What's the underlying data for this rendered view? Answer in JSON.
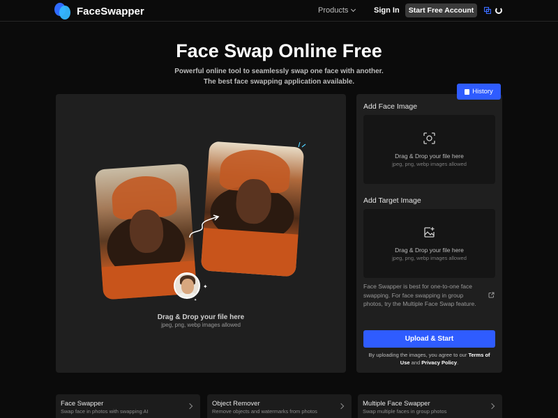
{
  "header": {
    "logo_text": "FaceSwapper",
    "products_label": "Products",
    "sign_in_label": "Sign In",
    "start_label": "Start Free Account"
  },
  "hero": {
    "title": "Face Swap Online Free",
    "subtitle": "Powerful online tool to seamlessly swap one face with another. The best face swapping application available."
  },
  "drop_panel": {
    "title": "Drag & Drop your file here",
    "subtitle": "jpeg, png, webp images allowed"
  },
  "right_panel": {
    "history_label": "History",
    "face_section_label": "Add Face Image",
    "face_upload_title": "Drag & Drop your file here",
    "face_upload_sub": "jpeg, png, webp images allowed",
    "target_section_label": "Add Target Image",
    "target_upload_title": "Drag & Drop your file here",
    "target_upload_sub": "jpeg, png, webp images allowed",
    "note": "Face Swapper is best for one-to-one face swapping. For face swapping in group photos, try the Multiple Face Swap feature.",
    "upload_button": "Upload & Start",
    "terms_prefix": "By uploading the images, you agree to our ",
    "terms_link": "Terms of Use",
    "terms_and": " and ",
    "privacy_link": "Privacy Policy",
    "terms_suffix": "."
  },
  "tools": [
    {
      "title": "Face Swapper",
      "desc": "Swap face in photos with swapping AI"
    },
    {
      "title": "Object Remover",
      "desc": "Remove objects and watermarks from photos"
    },
    {
      "title": "Multiple Face Swapper",
      "desc": "Swap multiple faces in group photos"
    }
  ],
  "colors": {
    "accent": "#2f5cff",
    "background": "#0b0b0b",
    "panel": "#1f1f1f"
  }
}
